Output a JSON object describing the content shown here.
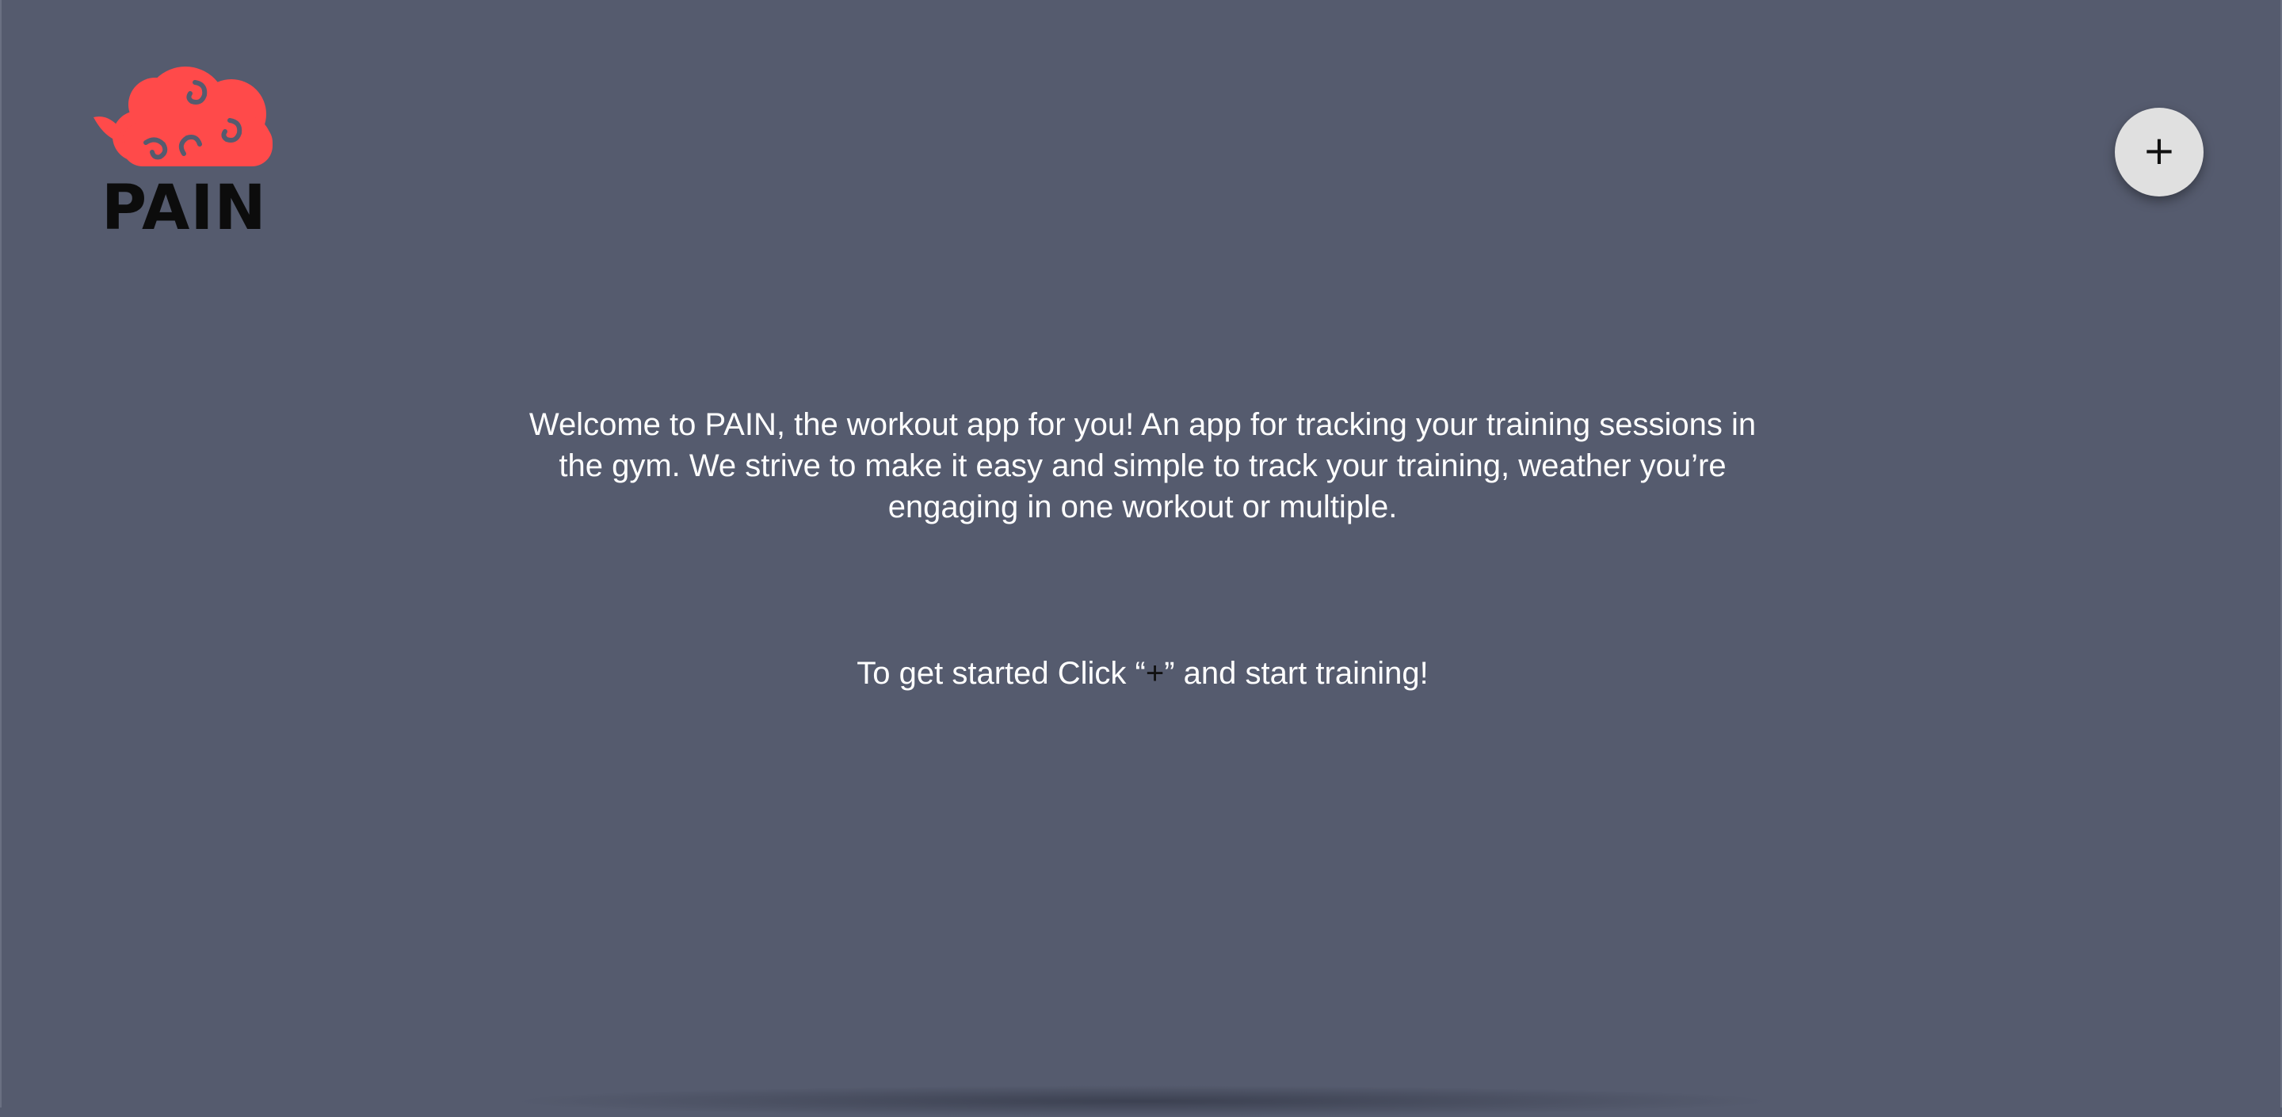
{
  "app": {
    "logo_text": "PAIN",
    "logo_icon": "red-cloud-logo",
    "background_color": "#555b6e",
    "accent_color": "#ff4a4a"
  },
  "header": {
    "add_button": {
      "label": "+",
      "icon": "plus-icon"
    }
  },
  "main": {
    "welcome_text": "Welcome to PAIN, the workout app for you! An app for tracking your training sessions in the gym. We strive to make it easy and simple to track your training, weather you’re engaging in one workout or multiple.",
    "get_started_prefix": "To get started Click “",
    "get_started_plus": "+",
    "get_started_suffix": "” and start training!"
  }
}
